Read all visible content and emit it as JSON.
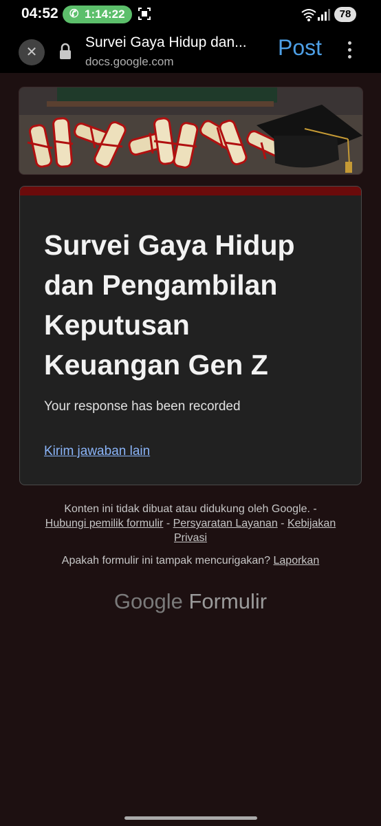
{
  "status_bar": {
    "time": "04:52",
    "call_duration": "1:14:22",
    "battery": "78"
  },
  "browser": {
    "tab_title": "Survei Gaya Hidup dan...",
    "url": "docs.google.com",
    "action_label": "Post"
  },
  "form": {
    "title": "Survei Gaya Hidup dan Pengambilan Keputusan Keuangan Gen Z",
    "confirmation": "Your response has been recorded",
    "resubmit_link": "Kirim jawaban lain",
    "accent_color": "#6b0b0b"
  },
  "footer": {
    "disclaimer": "Konten ini tidak dibuat atau didukung oleh Google. -",
    "contact_owner": "Hubungi pemilik formulir",
    "sep1": " - ",
    "terms": "Persyaratan Layanan",
    "sep2": " - ",
    "privacy": "Kebijakan Privasi",
    "report_question": "Apakah formulir ini tampak mencurigakan?",
    "report_link": "Laporkan",
    "brand_google": "Google",
    "brand_product": "Formulir"
  }
}
